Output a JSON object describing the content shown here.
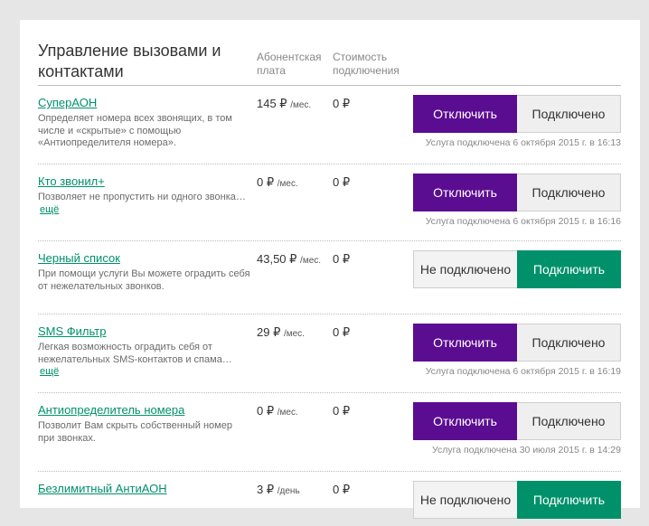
{
  "header": {
    "title": "Управление вызовами и контактами",
    "col_fee": "Абонентская плата",
    "col_cost": "Стоимость подключения"
  },
  "services": [
    {
      "name": "СуперАОН",
      "desc": "Определяет номера всех звонящих, в том числе и «скрытые» с помощью «Антиопределителя номера».",
      "more": "",
      "fee": "145 ₽",
      "fee_unit": "/мес.",
      "cost": "0 ₽",
      "state": "connected",
      "btn_left": "Отключить",
      "btn_right": "Подключено",
      "status": "Услуга подключена 6 октября 2015 г. в 16:13"
    },
    {
      "name": "Кто звонил+",
      "desc": "Позволяет не пропустить ни одного звонка…",
      "more": "ещё",
      "fee": "0 ₽",
      "fee_unit": "/мес.",
      "cost": "0 ₽",
      "state": "connected",
      "btn_left": "Отключить",
      "btn_right": "Подключено",
      "status": "Услуга подключена 6 октября 2015 г. в 16:16"
    },
    {
      "name": "Черный список",
      "desc": "При помощи услуги Вы можете оградить себя от нежелательных звонков.",
      "more": "",
      "fee": "43,50 ₽",
      "fee_unit": "/мес.",
      "cost": "0 ₽",
      "state": "disconnected",
      "btn_left": "Не подключено",
      "btn_right": "Подключить",
      "status": ""
    },
    {
      "name": "SMS Фильтр",
      "desc": "Легкая возможность оградить себя от нежелательных SMS-контактов и спама…",
      "more": "ещё",
      "fee": "29 ₽",
      "fee_unit": "/мес.",
      "cost": "0 ₽",
      "state": "connected",
      "btn_left": "Отключить",
      "btn_right": "Подключено",
      "status": "Услуга подключена 6 октября 2015 г. в 16:19"
    },
    {
      "name": "Антиопределитель номера",
      "desc": "Позволит Вам скрыть собственный номер при звонках.",
      "more": "",
      "fee": "0 ₽",
      "fee_unit": "/мес.",
      "cost": "0 ₽",
      "state": "connected",
      "btn_left": "Отключить",
      "btn_right": "Подключено",
      "status": "Услуга подключена 30 июля 2015 г. в 14:29"
    },
    {
      "name": "Безлимитный АнтиАОН",
      "desc": "",
      "more": "",
      "fee": "3 ₽",
      "fee_unit": "/день",
      "cost": "0 ₽",
      "state": "disconnected",
      "btn_left": "Не подключено",
      "btn_right": "Подключить",
      "status": ""
    }
  ],
  "colors": {
    "accent_purple": "#5b0d91",
    "accent_green": "#00916b",
    "link_green": "#00906b"
  }
}
